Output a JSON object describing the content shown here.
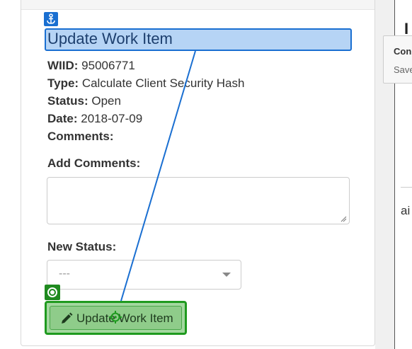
{
  "work_item": {
    "title": "Update Work Item",
    "wiid_label": "WIID:",
    "wiid_value": "95006771",
    "type_label": "Type:",
    "type_value": "Calculate Client Security Hash",
    "status_label": "Status:",
    "status_value": "Open",
    "date_label": "Date:",
    "date_value": "2018-07-09",
    "comments_label": "Comments:"
  },
  "form": {
    "add_comments_label": "Add Comments:",
    "add_comments_value": "",
    "new_status_label": "New Status:",
    "new_status_selected": "---",
    "submit_label": "Update Work Item"
  },
  "background": {
    "heading_fragment": "I",
    "tooltip_title": "Con",
    "tooltip_body": "Save",
    "text_fragment": "ai"
  },
  "icons": {
    "anchor": "anchor-icon",
    "target": "target-icon",
    "pencil": "pencil-icon",
    "crosshair": "crosshair-icon"
  },
  "colors": {
    "anchor_highlight": "#1a6fd1",
    "target_highlight": "#1f9a1f"
  }
}
